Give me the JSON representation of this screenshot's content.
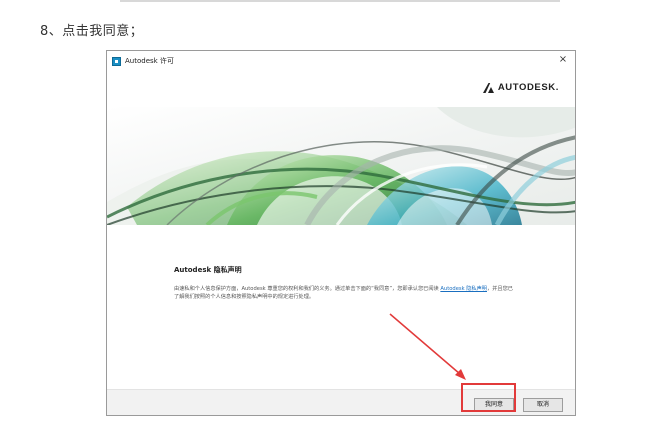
{
  "step_text": "8、点击我同意；",
  "window": {
    "title": "Autodesk 许可",
    "close_glyph": "×",
    "brand": "AUTODESK.",
    "heading": "Autodesk 隐私声明",
    "body_before_link": "由速私和个人信息保护方面，Autodesk 尊重您的权利和我们的义务。通过单击下面的“我同意”，您即承认您已阅读 ",
    "body_link": "Autodesk 隐私声明",
    "body_after_link": "，并且您已了解我们按照的个人信息和按照隐私声明中的规定进行处理。",
    "agree_label": "我同意",
    "cancel_label": "取消"
  },
  "colors": {
    "highlight": "#e23a3a",
    "link": "#1a6fc0"
  },
  "icons": [
    "app-icon",
    "close-icon",
    "autodesk-logo-icon",
    "annotation-arrow-icon"
  ]
}
